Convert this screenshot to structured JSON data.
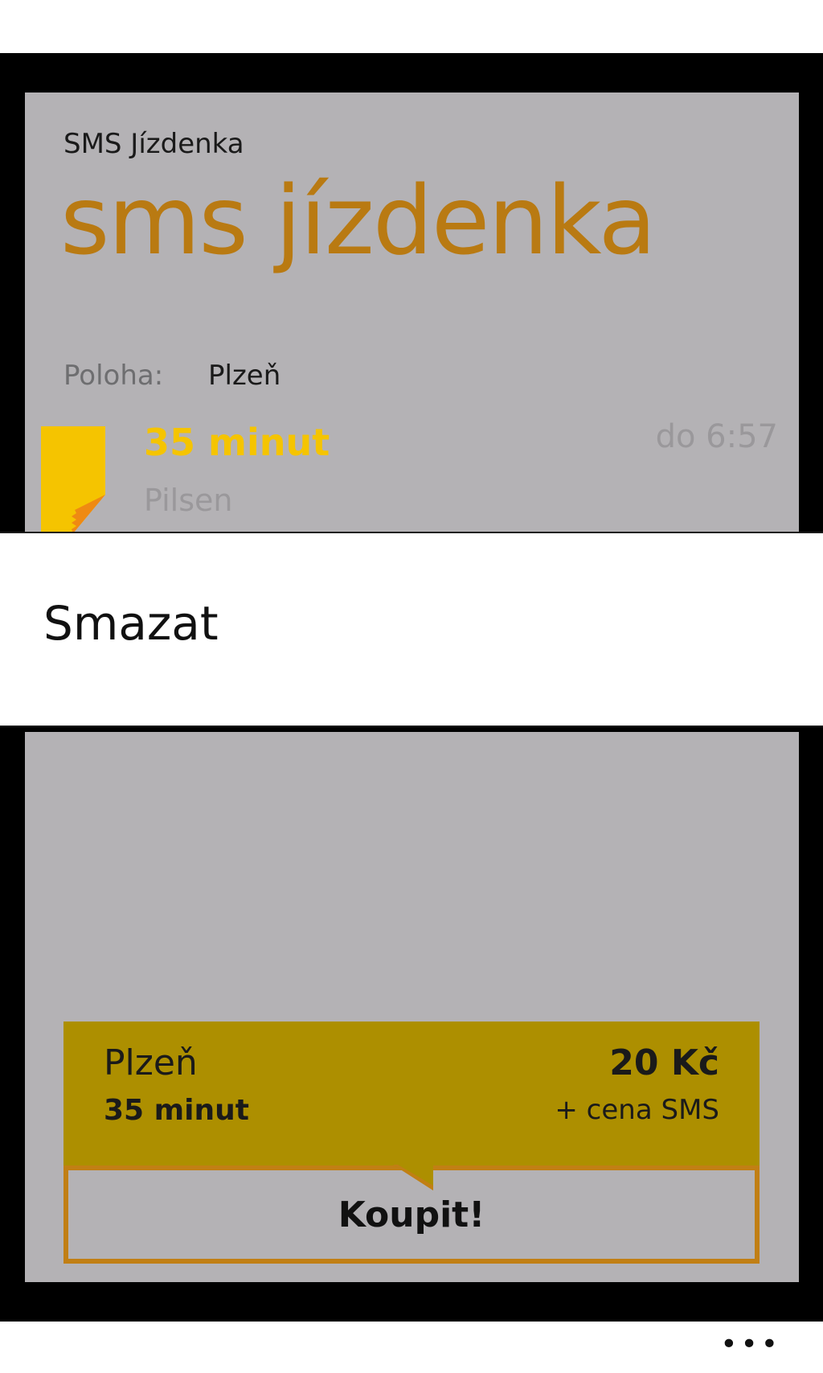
{
  "app": {
    "name": "SMS Jízdenka",
    "title": "sms jízdenka"
  },
  "location": {
    "label": "Poloha:",
    "value": "Plzeň"
  },
  "ticket": {
    "name": "35 minut",
    "valid_until": "do 6:57",
    "city": "Pilsen",
    "icon": "ticket-icon"
  },
  "context_menu": {
    "items": [
      "Smazat"
    ]
  },
  "offer": {
    "city": "Plzeň",
    "duration": "35 minut",
    "price": "20 Kč",
    "sms_note": "+ cena SMS",
    "buy_label": "Koupit!"
  },
  "appbar": {
    "more_label": "•••"
  },
  "colors": {
    "accent_title": "#b97a12",
    "ticket_highlight": "#f5c400",
    "offer_background": "#ad8f00",
    "buy_border": "#c17f14"
  }
}
